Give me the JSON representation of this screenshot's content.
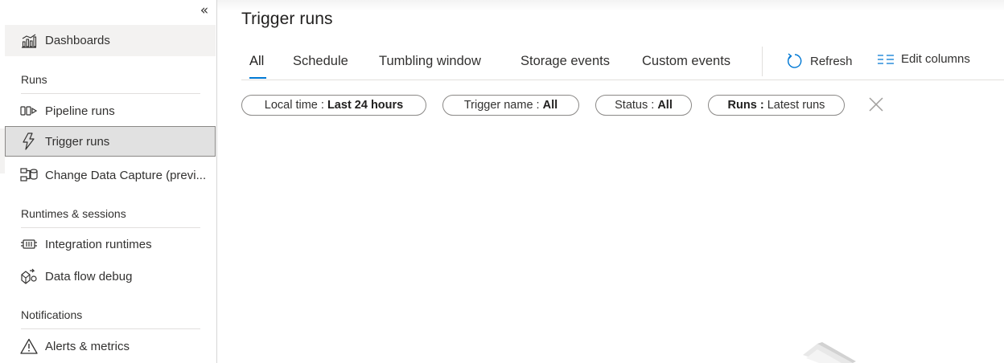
{
  "sidebar": {
    "collapse_label": "«",
    "dashboards": {
      "label": "Dashboards",
      "icon": "dashboard-chart-icon"
    },
    "sections": [
      {
        "header": "Runs"
      },
      {
        "header": "Runtimes & sessions"
      },
      {
        "header": "Notifications"
      }
    ],
    "items": {
      "pipeline_runs": {
        "label": "Pipeline runs",
        "icon": "pipeline-icon"
      },
      "trigger_runs": {
        "label": "Trigger runs",
        "icon": "trigger-lightning-icon",
        "selected": true
      },
      "change_data_capture": {
        "label": "Change Data Capture (previ...",
        "icon": "change-data-capture-icon"
      },
      "integration_runtimes": {
        "label": "Integration runtimes",
        "icon": "integration-runtime-icon"
      },
      "data_flow_debug": {
        "label": "Data flow debug",
        "icon": "data-flow-debug-icon"
      },
      "alerts_metrics": {
        "label": "Alerts & metrics",
        "icon": "warning-triangle-icon"
      }
    }
  },
  "main": {
    "title": "Trigger runs",
    "tabs": [
      {
        "label": "All",
        "selected": true
      },
      {
        "label": "Schedule"
      },
      {
        "label": "Tumbling window"
      },
      {
        "label": "Storage events"
      },
      {
        "label": "Custom events"
      }
    ],
    "commands": {
      "refresh": {
        "label": "Refresh",
        "icon": "refresh-icon"
      },
      "edit_columns": {
        "label": "Edit columns",
        "icon": "edit-columns-icon"
      }
    },
    "filters": [
      {
        "key": "Local time",
        "sep": " : ",
        "value": "Last 24 hours"
      },
      {
        "key": "Trigger name",
        "sep": " : ",
        "value": "All"
      },
      {
        "key": "Status",
        "sep": " : ",
        "value": "All"
      },
      {
        "key": "Runs",
        "sep": " : ",
        "value": "Latest runs"
      }
    ]
  },
  "colors": {
    "accent": "#0078d4",
    "selected_nav_bg": "#e1e1e1",
    "hover_nav_bg": "#f3f2f1",
    "border": "#8a8886"
  }
}
